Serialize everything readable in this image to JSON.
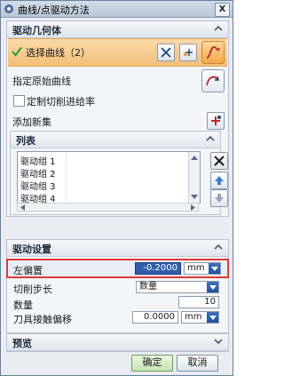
{
  "window": {
    "title": "曲线/点驱动方法",
    "close_label": "X"
  },
  "drive_geometry": {
    "title": "驱动几何体",
    "select_curve_label": "选择曲线（2）",
    "specify_original_curve": "指定原始曲线",
    "custom_feed_label": "定制切削进给率",
    "custom_feed_checked": false,
    "add_new_set": "添加新集"
  },
  "list": {
    "title": "列表",
    "items": [
      "驱动组 1",
      "驱动组 2",
      "驱动组 3",
      "驱动组 4"
    ]
  },
  "drive_settings": {
    "title": "驱动设置",
    "left_offset_label": "左偏置",
    "left_offset_value": "-0.2000",
    "left_offset_unit": "mm",
    "step_label": "切削步长",
    "step_value": "数量",
    "count_label": "数量",
    "count_value": "10",
    "tool_offset_label": "刀具接触偏移",
    "tool_offset_value": "0.0000",
    "tool_offset_unit": "mm"
  },
  "preview": {
    "title": "预览"
  },
  "buttons": {
    "ok": "确定",
    "cancel": "取消"
  },
  "colors": {
    "accent_band": "#f3c07a",
    "highlight": "#e03a3a",
    "dropdown": "#24509a"
  }
}
